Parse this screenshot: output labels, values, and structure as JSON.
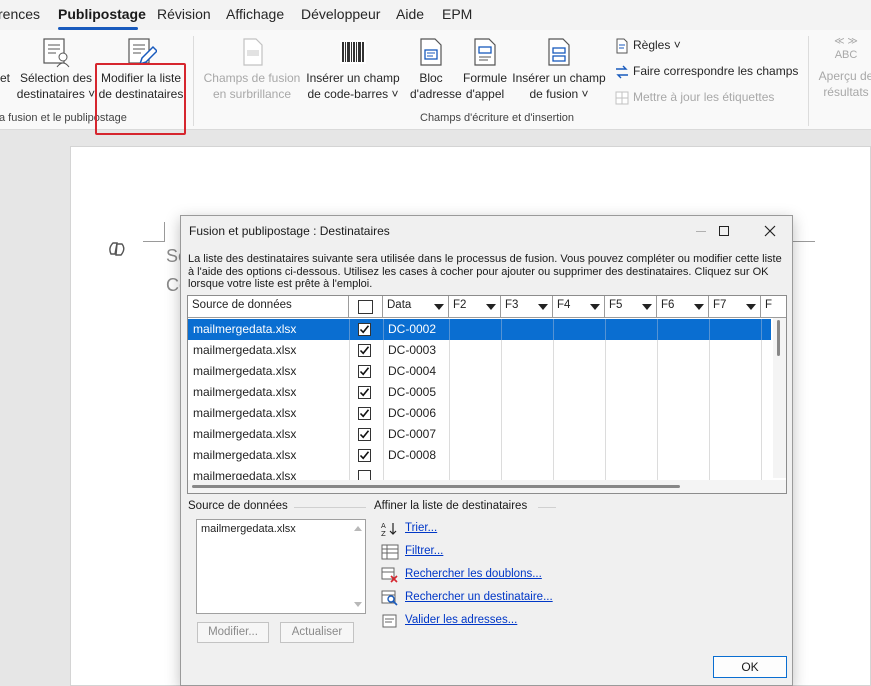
{
  "ribbon": {
    "tabs": [
      "rences",
      "Publipostage",
      "Révision",
      "Affichage",
      "Développeur",
      "Aide",
      "EPM"
    ],
    "active_tab": "Publipostage",
    "btn_left_partial": "et",
    "btn_select_l1": "Sélection des",
    "btn_select_l2": "destinataires ˅",
    "btn_edit_l1": "Modifier la liste",
    "btn_edit_l2": "de destinataires",
    "group1_label": "a fusion et le publipostage",
    "btn_highlight_l1": "Champs de fusion",
    "btn_highlight_l2": "en surbrillance",
    "btn_barcode_l1": "Insérer un champ",
    "btn_barcode_l2": "de code-barres ˅",
    "btn_address_l1": "Bloc",
    "btn_address_l2": "d'adresse",
    "btn_greeting_l1": "Formule",
    "btn_greeting_l2": "d'appel",
    "btn_insert_l1": "Insérer un champ",
    "btn_insert_l2": "de fusion ˅",
    "rules": "Règles ˅",
    "match_fields": "Faire correspondre les champs",
    "update_labels": "Mettre à jour les étiquettes",
    "group2_label": "Champs d'écriture et d'insertion",
    "preview_abc": "ABC",
    "preview_l1": "Aperçu de",
    "preview_l2": "résultats"
  },
  "document": {
    "text1": "Se",
    "text2": "Co"
  },
  "dialog": {
    "title": "Fusion et publipostage : Destinataires",
    "description": "La liste des destinataires suivante sera utilisée dans le processus de fusion. Vous pouvez compléter ou modifier cette liste à l'aide des options ci-dessous. Utilisez les cases à cocher pour ajouter ou supprimer des destinataires. Cliquez sur OK lorsque votre liste est prête à l'emploi.",
    "columns": [
      "Source de données",
      "",
      "Data",
      "F2",
      "F3",
      "F4",
      "F5",
      "F6",
      "F7",
      "F"
    ],
    "rows": [
      {
        "source": "mailmergedata.xlsx",
        "checked": true,
        "data": "DC-0002",
        "selected": true
      },
      {
        "source": "mailmergedata.xlsx",
        "checked": true,
        "data": "DC-0003",
        "selected": false
      },
      {
        "source": "mailmergedata.xlsx",
        "checked": true,
        "data": "DC-0004",
        "selected": false
      },
      {
        "source": "mailmergedata.xlsx",
        "checked": true,
        "data": "DC-0005",
        "selected": false
      },
      {
        "source": "mailmergedata.xlsx",
        "checked": true,
        "data": "DC-0006",
        "selected": false
      },
      {
        "source": "mailmergedata.xlsx",
        "checked": true,
        "data": "DC-0007",
        "selected": false
      },
      {
        "source": "mailmergedata.xlsx",
        "checked": true,
        "data": "DC-0008",
        "selected": false
      },
      {
        "source": "mailmergedata.xlsx",
        "checked": false,
        "data": "",
        "selected": false
      }
    ],
    "source_section": "Source de données",
    "source_item": "mailmergedata.xlsx",
    "modify_btn": "Modifier...",
    "refresh_btn": "Actualiser",
    "refine_section": "Affiner la liste de destinataires",
    "links": [
      "Trier...",
      "Filtrer...",
      "Rechercher les doublons...",
      "Rechercher un destinataire...",
      "Valider les adresses..."
    ],
    "ok_btn": "OK"
  },
  "colors": {
    "accent": "#185abd",
    "selection": "#0a6ed1",
    "highlight_border": "#d6262e",
    "link": "#0037c7"
  }
}
